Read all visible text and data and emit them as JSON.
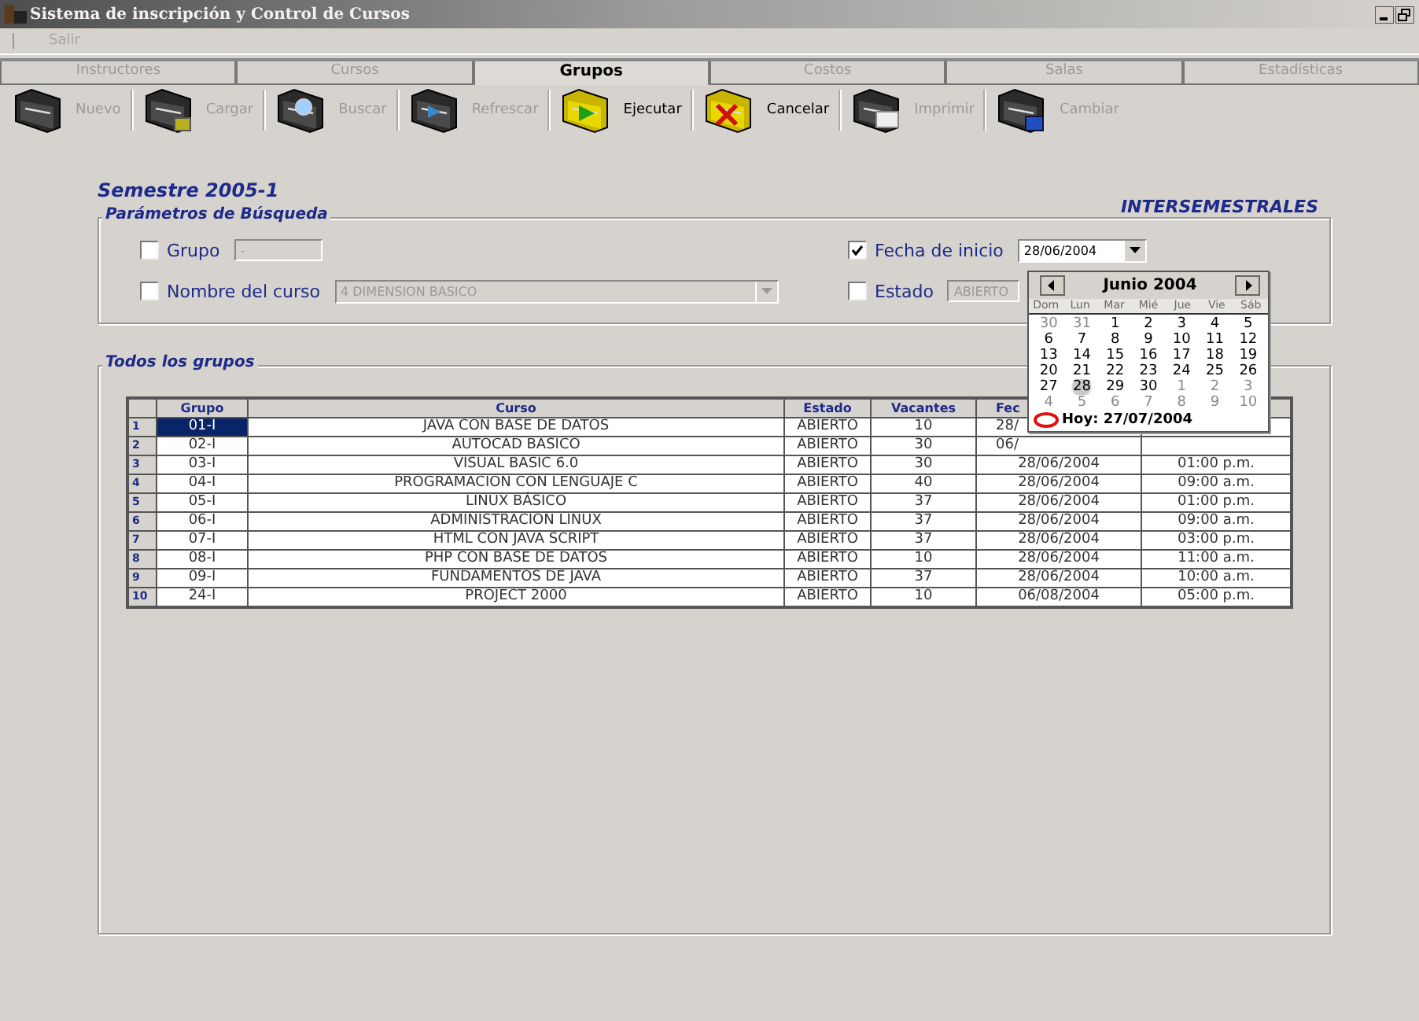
{
  "window": {
    "title": "Sistema de inscripción y Control de Cursos"
  },
  "menu": [
    "Salir"
  ],
  "tabs": [
    {
      "label": "Instructores",
      "selected": false
    },
    {
      "label": "Cursos",
      "selected": false
    },
    {
      "label": "Grupos",
      "selected": true
    },
    {
      "label": "Costos",
      "selected": false
    },
    {
      "label": "Salas",
      "selected": false
    },
    {
      "label": "Estadísticas",
      "selected": false
    }
  ],
  "toolbar": [
    {
      "label": "Nuevo",
      "kind": "plain",
      "disabled": true
    },
    {
      "label": "Cargar",
      "kind": "load",
      "disabled": true
    },
    {
      "label": "Buscar",
      "kind": "search",
      "disabled": true
    },
    {
      "label": "Refrescar",
      "kind": "refresh",
      "disabled": true
    },
    {
      "label": "Ejecutar",
      "kind": "run",
      "disabled": false
    },
    {
      "label": "Cancelar",
      "kind": "cancel",
      "disabled": false
    },
    {
      "label": "Imprimir",
      "kind": "print",
      "disabled": true
    },
    {
      "label": "Cambiar",
      "kind": "change",
      "disabled": true
    }
  ],
  "semester": "Semestre  2005-1",
  "period": "INTERSEMESTRALES",
  "search_params": {
    "title": "Parámetros de Búsqueda",
    "grupo": {
      "label": "Grupo",
      "checked": false,
      "value": "-"
    },
    "nombre": {
      "label": "Nombre del curso",
      "checked": false,
      "value": "4 DIMENSION BASICO"
    },
    "fecha": {
      "label": "Fecha de inicio",
      "checked": true,
      "value": "28/06/2004"
    },
    "estado": {
      "label": "Estado",
      "checked": false,
      "value": "ABIERTO"
    }
  },
  "calendar": {
    "month": "Junio 2004",
    "weekdays": [
      "Dom",
      "Lun",
      "Mar",
      "Mié",
      "Jue",
      "Vie",
      "Sáb"
    ],
    "days": [
      {
        "day": "30",
        "muted": true,
        "selected": false
      },
      {
        "day": "31",
        "muted": true,
        "selected": false
      },
      {
        "day": "1",
        "muted": false,
        "selected": false
      },
      {
        "day": "2",
        "muted": false,
        "selected": false
      },
      {
        "day": "3",
        "muted": false,
        "selected": false
      },
      {
        "day": "4",
        "muted": false,
        "selected": false
      },
      {
        "day": "5",
        "muted": false,
        "selected": false
      },
      {
        "day": "6",
        "muted": false,
        "selected": false
      },
      {
        "day": "7",
        "muted": false,
        "selected": false
      },
      {
        "day": "8",
        "muted": false,
        "selected": false
      },
      {
        "day": "9",
        "muted": false,
        "selected": false
      },
      {
        "day": "10",
        "muted": false,
        "selected": false
      },
      {
        "day": "11",
        "muted": false,
        "selected": false
      },
      {
        "day": "12",
        "muted": false,
        "selected": false
      },
      {
        "day": "13",
        "muted": false,
        "selected": false
      },
      {
        "day": "14",
        "muted": false,
        "selected": false
      },
      {
        "day": "15",
        "muted": false,
        "selected": false
      },
      {
        "day": "16",
        "muted": false,
        "selected": false
      },
      {
        "day": "17",
        "muted": false,
        "selected": false
      },
      {
        "day": "18",
        "muted": false,
        "selected": false
      },
      {
        "day": "19",
        "muted": false,
        "selected": false
      },
      {
        "day": "20",
        "muted": false,
        "selected": false
      },
      {
        "day": "21",
        "muted": false,
        "selected": false
      },
      {
        "day": "22",
        "muted": false,
        "selected": false
      },
      {
        "day": "23",
        "muted": false,
        "selected": false
      },
      {
        "day": "24",
        "muted": false,
        "selected": false
      },
      {
        "day": "25",
        "muted": false,
        "selected": false
      },
      {
        "day": "26",
        "muted": false,
        "selected": false
      },
      {
        "day": "27",
        "muted": false,
        "selected": false
      },
      {
        "day": "28",
        "muted": false,
        "selected": true
      },
      {
        "day": "29",
        "muted": false,
        "selected": false
      },
      {
        "day": "30",
        "muted": false,
        "selected": false
      },
      {
        "day": "1",
        "muted": true,
        "selected": false
      },
      {
        "day": "2",
        "muted": true,
        "selected": false
      },
      {
        "day": "3",
        "muted": true,
        "selected": false
      },
      {
        "day": "4",
        "muted": true,
        "selected": false
      },
      {
        "day": "5",
        "muted": true,
        "selected": false
      },
      {
        "day": "6",
        "muted": true,
        "selected": false
      },
      {
        "day": "7",
        "muted": true,
        "selected": false
      },
      {
        "day": "8",
        "muted": true,
        "selected": false
      },
      {
        "day": "9",
        "muted": true,
        "selected": false
      },
      {
        "day": "10",
        "muted": true,
        "selected": false
      }
    ],
    "today": "Hoy: 27/07/2004"
  },
  "groups": {
    "title": "Todos los grupos",
    "table": {
      "columns": [
        "Grupo",
        "Curso",
        "Estado",
        "Vacantes",
        "Fec"
      ],
      "rows": [
        {
          "num": "1",
          "grupo": "01-I",
          "curso": "JAVA CON BASE DE DATOS",
          "estado": "ABIERTO",
          "vacantes": "10",
          "fecha": "28/",
          "covered": true,
          "selected": true
        },
        {
          "num": "2",
          "grupo": "02-I",
          "curso": "AUTOCAD BASICO",
          "estado": "ABIERTO",
          "vacantes": "30",
          "fecha": "06/",
          "covered": true,
          "selected": false
        },
        {
          "num": "3",
          "grupo": "03-I",
          "curso": "VISUAL BASIC 6.0",
          "estado": "ABIERTO",
          "vacantes": "30",
          "fecha": "28/06/2004",
          "hora": "01:00 p.m.",
          "covered": false,
          "selected": false
        },
        {
          "num": "4",
          "grupo": "04-I",
          "curso": "PROGRAMACION CON LENGUAJE C",
          "estado": "ABIERTO",
          "vacantes": "40",
          "fecha": "28/06/2004",
          "hora": "09:00 a.m.",
          "covered": false,
          "selected": false
        },
        {
          "num": "5",
          "grupo": "05-I",
          "curso": "LINUX BÁSICO",
          "estado": "ABIERTO",
          "vacantes": "37",
          "fecha": "28/06/2004",
          "hora": "01:00 p.m.",
          "covered": false,
          "selected": false
        },
        {
          "num": "6",
          "grupo": "06-I",
          "curso": "ADMINISTRACION LINUX",
          "estado": "ABIERTO",
          "vacantes": "37",
          "fecha": "28/06/2004",
          "hora": "09:00 a.m.",
          "covered": false,
          "selected": false
        },
        {
          "num": "7",
          "grupo": "07-I",
          "curso": "HTML CON JAVA SCRIPT",
          "estado": "ABIERTO",
          "vacantes": "37",
          "fecha": "28/06/2004",
          "hora": "03:00 p.m.",
          "covered": false,
          "selected": false
        },
        {
          "num": "8",
          "grupo": "08-I",
          "curso": "PHP CON BASE DE DATOS",
          "estado": "ABIERTO",
          "vacantes": "10",
          "fecha": "28/06/2004",
          "hora": "11:00 a.m.",
          "covered": false,
          "selected": false
        },
        {
          "num": "9",
          "grupo": "09-I",
          "curso": "FUNDAMENTOS DE JAVA",
          "estado": "ABIERTO",
          "vacantes": "37",
          "fecha": "28/06/2004",
          "hora": "10:00 a.m.",
          "covered": false,
          "selected": false
        },
        {
          "num": "10",
          "grupo": "24-I",
          "curso": "PROJECT 2000",
          "estado": "ABIERTO",
          "vacantes": "10",
          "fecha": "06/08/2004",
          "hora": "05:00 p.m.",
          "covered": false,
          "selected": false
        }
      ]
    }
  }
}
